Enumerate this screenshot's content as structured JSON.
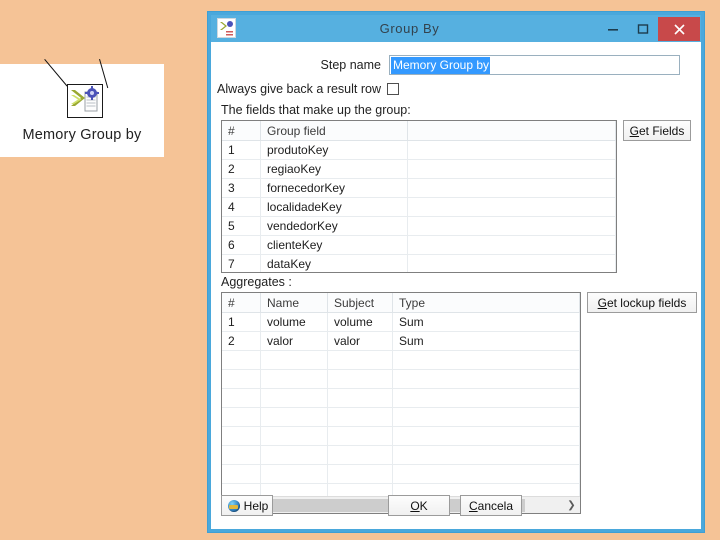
{
  "slide": {
    "card_caption": "Memory Group by",
    "step_icon": "sigma-group-by-icon",
    "callout_icon": "callout-line"
  },
  "dialog": {
    "title": "Group By",
    "app_icon": "group-by-app-icon",
    "window_controls": {
      "minimize": "–",
      "maximize": "❑",
      "close": "✕"
    },
    "step_name": {
      "label": "Step name",
      "value": "Memory Group by",
      "placeholder": ""
    },
    "always_result_row": {
      "label": "Always give back a result row",
      "checked": false
    },
    "fields_section": {
      "label": "The fields that make up the group:",
      "columns": [
        "#",
        "Group field",
        ""
      ],
      "rows": [
        [
          "1",
          "produtoKey",
          ""
        ],
        [
          "2",
          "regiaoKey",
          ""
        ],
        [
          "3",
          "fornecedorKey",
          ""
        ],
        [
          "4",
          "localidadeKey",
          ""
        ],
        [
          "5",
          "vendedorKey",
          ""
        ],
        [
          "6",
          "clienteKey",
          ""
        ],
        [
          "7",
          "dataKey",
          ""
        ]
      ],
      "get_fields_button": "Get Fields"
    },
    "aggregates_section": {
      "label": "Aggregates :",
      "columns": [
        "#",
        "Name",
        "Subject",
        "Type"
      ],
      "rows": [
        [
          "1",
          "volume",
          "volume",
          "Sum"
        ],
        [
          "2",
          "valor",
          "valor",
          "Sum"
        ]
      ],
      "get_lookup_button": "Get lockup fields",
      "scroll_left_icon": "chevron-left-icon",
      "scroll_right_icon": "chevron-right-icon"
    },
    "footer": {
      "help": "Help",
      "ok": "OK",
      "cancel": "Cancela"
    }
  },
  "colors": {
    "background": "#f5c396",
    "titlebar": "#56b0e0",
    "window_border": "#4aa8dc",
    "close_button": "#c8494a",
    "selection": "#3399ff"
  }
}
